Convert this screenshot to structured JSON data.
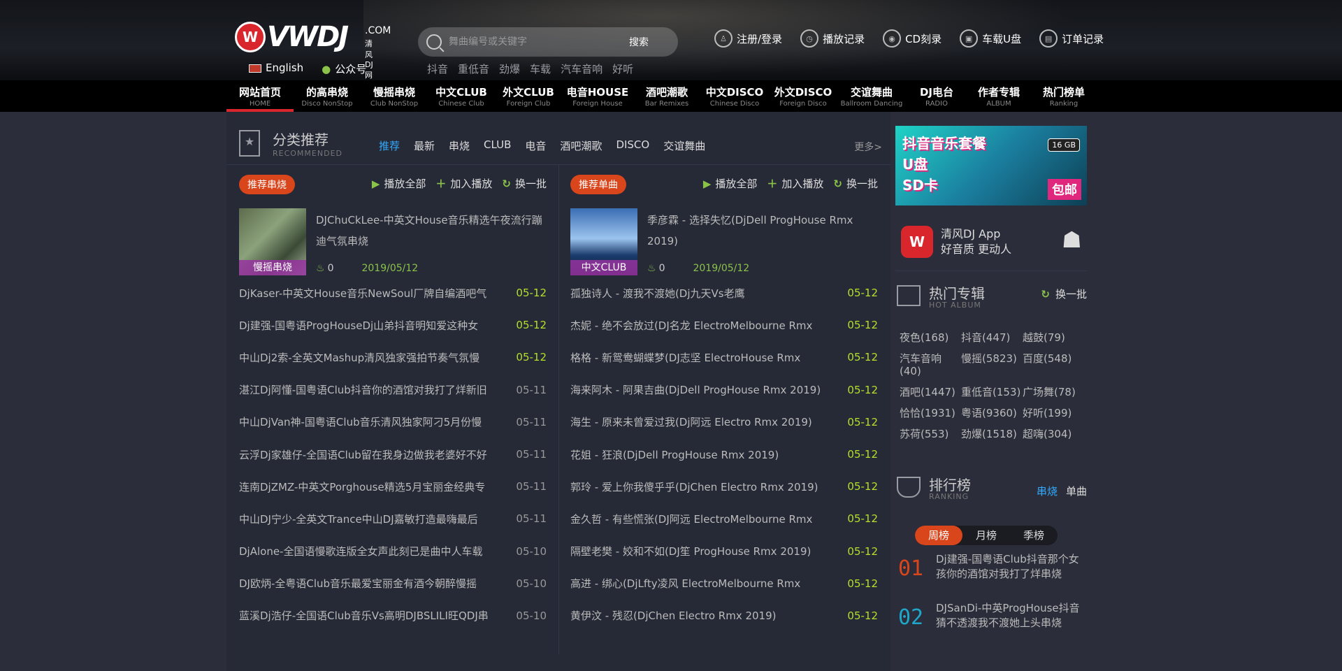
{
  "header": {
    "logo_text": "VWDJ",
    "logo_domain": ".COM",
    "logo_sub": "清风DJ网",
    "lang_label": "English",
    "wechat_label": "公众号",
    "search_placeholder": "舞曲编号或关键字",
    "search_button": "搜索",
    "hot_words": [
      "抖音",
      "重低音",
      "劲爆",
      "车载",
      "汽车音响",
      "好听"
    ],
    "top_links": [
      {
        "label": "注册/登录",
        "icon": "user-icon"
      },
      {
        "label": "播放记录",
        "icon": "clock-icon"
      },
      {
        "label": "CD刻录",
        "icon": "disc-icon"
      },
      {
        "label": "车载U盘",
        "icon": "usb-icon"
      },
      {
        "label": "订单记录",
        "icon": "order-icon"
      }
    ]
  },
  "nav": [
    {
      "cn": "网站首页",
      "en": "HOME",
      "w": 96
    },
    {
      "cn": "的高串烧",
      "en": "Disco NonStop",
      "w": 96
    },
    {
      "cn": "慢摇串烧",
      "en": "Club NonStop",
      "w": 96
    },
    {
      "cn": "中文CLUB",
      "en": "Chinese Club",
      "w": 96
    },
    {
      "cn": "外文CLUB",
      "en": "Foreign Club",
      "w": 96
    },
    {
      "cn": "电音HOUSE",
      "en": "Foreign House",
      "w": 102
    },
    {
      "cn": "酒吧潮歌",
      "en": "Bar Remixes",
      "w": 96
    },
    {
      "cn": "中文DISCO",
      "en": "Chinese Disco",
      "w": 98
    },
    {
      "cn": "外文DISCO",
      "en": "Foreign Disco",
      "w": 98
    },
    {
      "cn": "交谊舞曲",
      "en": "Ballroom Dancing",
      "w": 98
    },
    {
      "cn": "DJ电台",
      "en": "RADIO",
      "w": 88
    },
    {
      "cn": "作者专辑",
      "en": "ALBUM",
      "w": 90
    },
    {
      "cn": "热门榜单",
      "en": "Ranking",
      "w": 96
    }
  ],
  "category": {
    "title": "分类推荐",
    "subtitle": "RECOMMENDED",
    "tabs": [
      "推荐",
      "最新",
      "串烧",
      "CLUB",
      "电音",
      "酒吧潮歌",
      "DISCO",
      "交谊舞曲"
    ],
    "more": "更多>"
  },
  "left": {
    "pill": "推荐串烧",
    "actions": {
      "play_all": "播放全部",
      "add_play": "加入播放",
      "refresh": "换一批"
    },
    "feature": {
      "thumb_label": "慢摇串烧",
      "title": "DJChuCkLee-中英文House音乐精选午夜流行蹦迪气氛串烧",
      "plays": "0",
      "date": "2019/05/12"
    },
    "rows": [
      {
        "t": "DjKaser-中英文House音乐NewSoul厂牌自编酒吧气",
        "d": "05-12",
        "hl": true
      },
      {
        "t": "Dj建强-国粤语ProgHouseDj山弟抖音明知爱这种女",
        "d": "05-12",
        "hl": true
      },
      {
        "t": "中山Dj2索-全英文Mashup清风独家强拍节奏气氛慢",
        "d": "05-12",
        "hl": true
      },
      {
        "t": "湛江Dj阿懂-国粤语Club抖音你的酒馆对我打了烊新旧",
        "d": "05-11",
        "hl": false
      },
      {
        "t": "中山DjVan神-国粤语Club音乐清风独家阿刁5月份慢",
        "d": "05-11",
        "hl": false
      },
      {
        "t": "云浮Dj家雄仔-全国语Club留在我身边做我老婆好不好",
        "d": "05-11",
        "hl": false
      },
      {
        "t": "连南DjZMZ-中英文Porghouse精选5月宝丽金经典专",
        "d": "05-11",
        "hl": false
      },
      {
        "t": "中山DJ宁少-全英文Trance中山DJ嘉敏打造最嗨最后",
        "d": "05-11",
        "hl": false
      },
      {
        "t": "DjAlone-全国语慢歌连版全女声此刻已是曲中人车载",
        "d": "05-10",
        "hl": false
      },
      {
        "t": "DJ欧炳-全粤语Club音乐最爱宝丽金有酒今朝醉慢摇",
        "d": "05-10",
        "hl": false
      },
      {
        "t": "蓝溪Dj浩仔-全国语Club音乐Vs高明DJBSLILI旺QDJ串",
        "d": "05-10",
        "hl": false
      }
    ]
  },
  "right": {
    "pill": "推荐单曲",
    "actions": {
      "play_all": "播放全部",
      "add_play": "加入播放",
      "refresh": "换一批"
    },
    "feature": {
      "thumb_label": "中文CLUB",
      "title": "季彦霖 - 选择失忆(DjDell ProgHouse Rmx 2019)",
      "plays": "0",
      "date": "2019/05/12"
    },
    "rows": [
      {
        "t": "孤独诗人 - 渡我不渡她(Dj九天Vs老鹰",
        "d": "05-12",
        "hl": true
      },
      {
        "t": "杰妮 - 绝不会放过(DJ名龙 ElectroMelbourne Rmx",
        "d": "05-12",
        "hl": true
      },
      {
        "t": "格格 - 新鸳鸯蝴蝶梦(DJ志坚 ElectroHouse Rmx",
        "d": "05-12",
        "hl": true
      },
      {
        "t": "海来阿木 - 阿果吉曲(DjDell ProgHouse Rmx 2019)",
        "d": "05-12",
        "hl": true
      },
      {
        "t": "海生 - 原来未曾爱过我(Dj阿远 Electro Rmx 2019)",
        "d": "05-12",
        "hl": true
      },
      {
        "t": "花姐 - 狂浪(DjDell ProgHouse Rmx 2019)",
        "d": "05-12",
        "hl": true
      },
      {
        "t": "郭玲 - 爱上你我傻乎乎(DjChen Electro Rmx 2019)",
        "d": "05-12",
        "hl": true
      },
      {
        "t": "金久哲 - 有些慌张(DJ阿远 ElectroMelbourne Rmx",
        "d": "05-12",
        "hl": true
      },
      {
        "t": "隔壁老樊 - 姣和不如(DJ笙 ProgHouse Rmx 2019)",
        "d": "05-12",
        "hl": true
      },
      {
        "t": "高进 - 绑心(DjLfty凌风 ElectroMelbourne Rmx",
        "d": "05-12",
        "hl": true
      },
      {
        "t": "黄伊汶 - 残忍(DjChen Electro Rmx 2019)",
        "d": "05-12",
        "hl": true
      }
    ]
  },
  "side": {
    "banner": {
      "line1": "抖音音乐套餐",
      "line2": "U盘",
      "line3": "SD卡",
      "badge": "16 GB",
      "buy": "包邮"
    },
    "app": {
      "line1": "清风DJ App",
      "line2": "好音质  更动人"
    },
    "album": {
      "title": "热门专辑",
      "subtitle": "HOT ALBUM",
      "refresh": "换一批",
      "tags": [
        "夜色(168)",
        "抖音(447)",
        "越鼓(79)",
        "汽车音响(40)",
        "慢摇(5823)",
        "百度(548)",
        "酒吧(1447)",
        "重低音(153)",
        "广场舞(78)",
        "恰恰(1931)",
        "粤语(9360)",
        "好听(199)",
        "苏荷(553)",
        "劲爆(1518)",
        "超嗨(304)"
      ]
    },
    "ranking": {
      "title": "排行榜",
      "subtitle": "RANKING",
      "tab1": "串烧",
      "tab2": "单曲",
      "periods": [
        "周榜",
        "月榜",
        "季榜"
      ],
      "items": [
        {
          "num": "01",
          "text": "Dj建强-国粤语Club抖音那个女孩你的酒馆对我打了烊串烧",
          "color": "#d9461c"
        },
        {
          "num": "02",
          "text": "DJSanDi-中英ProgHouse抖音猜不透渡我不渡她上头串烧",
          "color": "#1fa7c9"
        }
      ]
    }
  }
}
